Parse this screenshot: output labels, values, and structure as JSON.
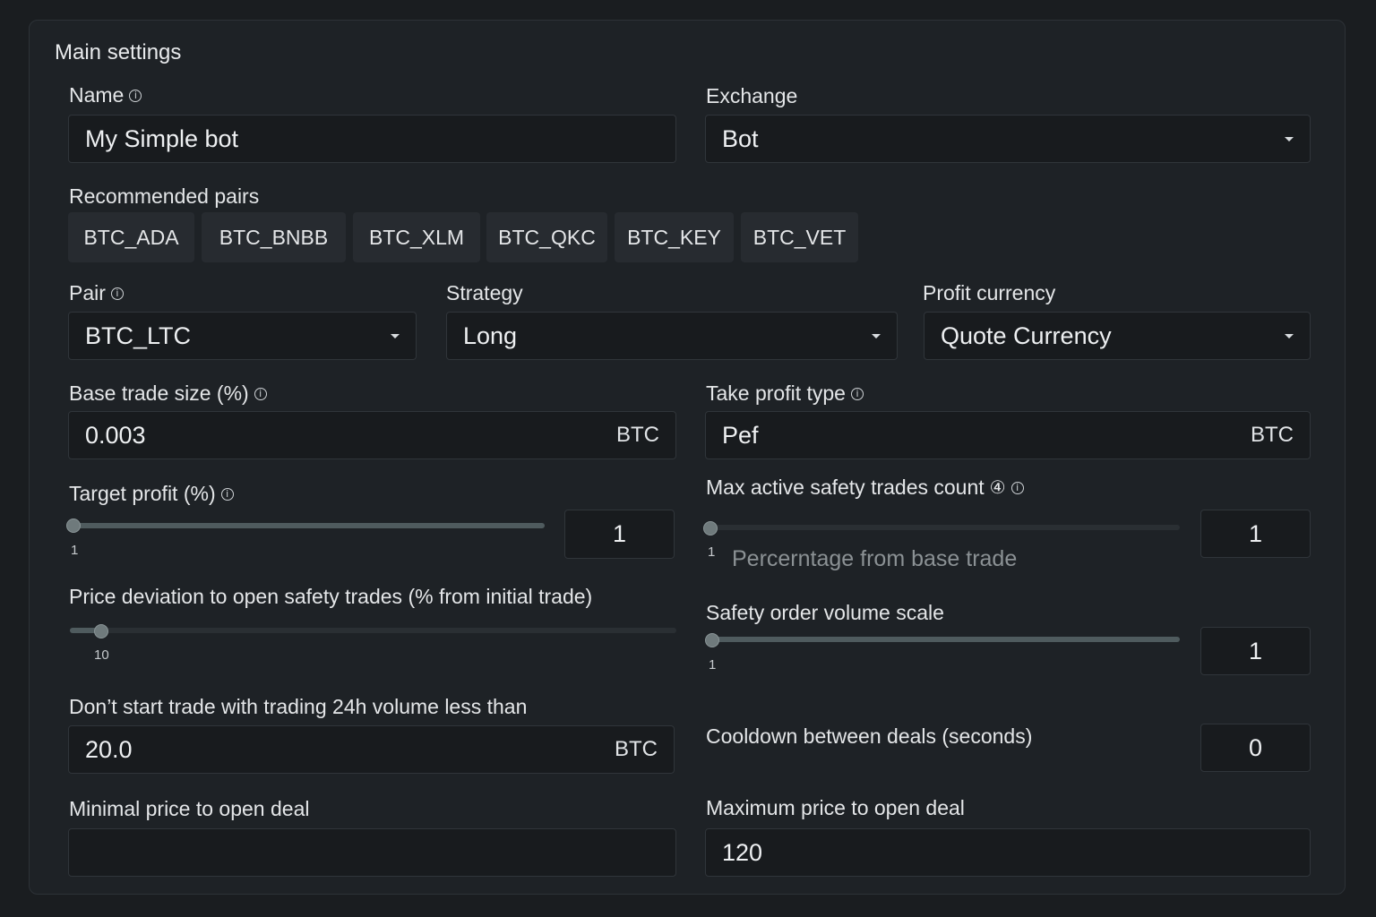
{
  "section": {
    "title": "Main settings"
  },
  "name": {
    "label": "Name",
    "value": "My Simple bot"
  },
  "exchange": {
    "label": "Exchange",
    "value": "Bot"
  },
  "recommended": {
    "label": "Recommended pairs",
    "pairs": [
      "BTC_ADA",
      "BTC_BNBB",
      "BTC_XLM",
      "BTC_QKC",
      "BTC_KEY",
      "BTC_VET"
    ]
  },
  "pair": {
    "label": "Pair",
    "value": "BTC_LTC"
  },
  "strategy": {
    "label": "Strategy",
    "value": "Long"
  },
  "profit_currency": {
    "label": "Profit currency",
    "value": "Quote Currency"
  },
  "base_trade": {
    "label": "Base trade size (%)",
    "value": "0.003",
    "suffix": "BTC"
  },
  "take_profit_type": {
    "label": "Take profit type",
    "value": "Pef",
    "suffix": "BTC"
  },
  "target_profit": {
    "label": "Target profit (%)",
    "slider_min_label": "1",
    "value": "1"
  },
  "max_safety": {
    "label": "Max active safety trades count",
    "badge": "④",
    "slider_min_label": "1",
    "hint": "Percerntage from base trade",
    "value": "1"
  },
  "price_deviation": {
    "label": "Price deviation to open safety trades (% from initial trade)",
    "slider_value_label": "10"
  },
  "safety_volume": {
    "label": "Safety order volume scale",
    "slider_min_label": "1",
    "value": "1"
  },
  "volume_filter": {
    "label": "Don’t start trade with trading 24h volume less than",
    "value": "20.0",
    "suffix": "BTC"
  },
  "cooldown": {
    "label": "Cooldown between deals (seconds)",
    "value": "0"
  },
  "min_price": {
    "label": "Minimal price to open deal",
    "value": ""
  },
  "max_price": {
    "label": "Maximum price to open deal",
    "value": "120"
  }
}
